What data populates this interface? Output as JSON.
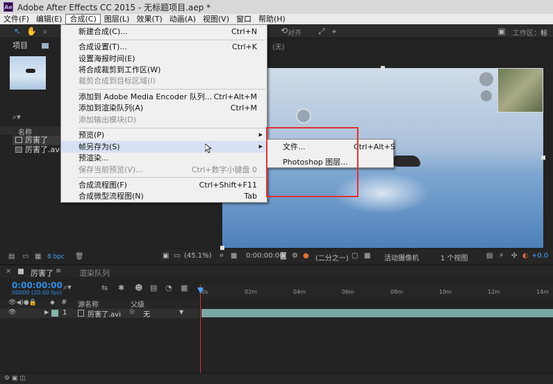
{
  "window": {
    "title": "Adobe After Effects CC 2015 - 无标题项目.aep *",
    "logo": "Ae"
  },
  "menubar": {
    "items": [
      "文件(F)",
      "编辑(E)",
      "合成(C)",
      "图层(L)",
      "效果(T)",
      "动画(A)",
      "视图(V)",
      "窗口",
      "帮助(H)"
    ],
    "active_index": 2
  },
  "toolbar": {
    "align_label": "对齐",
    "workspace_label": "工作区：",
    "workspace_value": "标准",
    "icons": [
      "selection-tool-icon",
      "hand-tool-icon",
      "zoom-tool-icon"
    ]
  },
  "project_panel": {
    "tab_label": "项目",
    "column_name": "名称",
    "items": [
      {
        "label": "厉害了",
        "type": "composition"
      },
      {
        "label": "厉害了.avi",
        "type": "footage"
      }
    ],
    "bpc_label": "8 bpc"
  },
  "viewer": {
    "tab_none": "(无)",
    "footer": {
      "zoom": "(45.1%)",
      "time": "0:00:00:00",
      "resolution": "(二分之一)",
      "camera": "活动摄像机",
      "views": "1 个视图",
      "exposure": "+0.0"
    }
  },
  "composition_menu": {
    "groups": [
      [
        {
          "label": "新建合成(C)...",
          "shortcut": "Ctrl+N",
          "enabled": true
        }
      ],
      [
        {
          "label": "合成设置(T)...",
          "shortcut": "Ctrl+K",
          "enabled": true
        },
        {
          "label": "设置海报时间(E)",
          "shortcut": "",
          "enabled": true
        },
        {
          "label": "将合成裁剪到工作区(W)",
          "shortcut": "",
          "enabled": true
        },
        {
          "label": "裁剪合成到目标区域(I)",
          "shortcut": "",
          "enabled": false
        }
      ],
      [
        {
          "label": "添加到 Adobe Media Encoder 队列...",
          "shortcut": "Ctrl+Alt+M",
          "enabled": true
        },
        {
          "label": "添加到渲染队列(A)",
          "shortcut": "Ctrl+M",
          "enabled": true
        },
        {
          "label": "添加输出模块(D)",
          "shortcut": "",
          "enabled": false
        }
      ],
      [
        {
          "label": "预览(P)",
          "shortcut": "",
          "enabled": true,
          "submenu": true
        },
        {
          "label": "帧另存为(S)",
          "shortcut": "",
          "enabled": true,
          "submenu": true,
          "highlighted": true
        },
        {
          "label": "预渲染...",
          "shortcut": "",
          "enabled": true
        },
        {
          "label": "保存当前预览(V)...",
          "shortcut": "Ctrl+数字小键盘 0",
          "enabled": false
        }
      ],
      [
        {
          "label": "合成流程图(F)",
          "shortcut": "Ctrl+Shift+F11",
          "enabled": true
        },
        {
          "label": "合成微型流程图(N)",
          "shortcut": "Tab",
          "enabled": true
        }
      ]
    ]
  },
  "save_frame_submenu": [
    {
      "label": "文件...",
      "shortcut": "Ctrl+Alt+S"
    },
    {
      "label": "Photoshop 图层...",
      "shortcut": ""
    }
  ],
  "timeline": {
    "tab_label": "厉害了",
    "render_queue_tab": "渲染队列",
    "timecode": "0:00:00:00",
    "fps": "00000 (20.00 fps)",
    "ruler_ticks": [
      "0s",
      "02m",
      "04m",
      "06m",
      "08m",
      "10m",
      "12m",
      "14m"
    ],
    "col_source_name": "源名称",
    "col_parent": "父级",
    "col_hash": "#",
    "layer": {
      "number": "1",
      "name": "厉害了.avi",
      "parent": "无"
    }
  },
  "colors": {
    "timecode": "#2f8fe8",
    "highlight_box": "#e23030",
    "layer_bar": "#79a6a1",
    "playhead": "#d23a2a"
  }
}
